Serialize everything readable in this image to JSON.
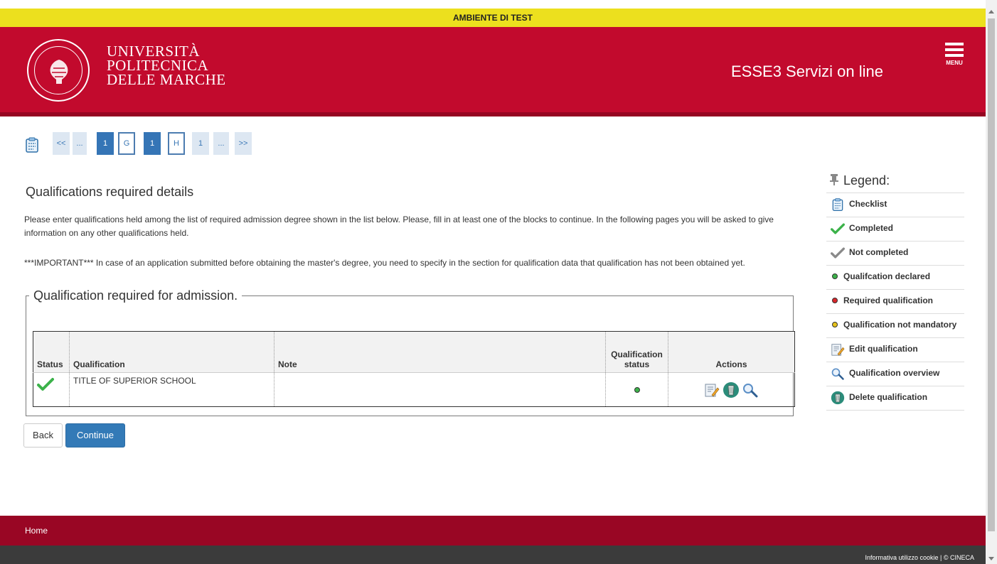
{
  "banner": {
    "text": "AMBIENTE DI TEST"
  },
  "header": {
    "univ_line1": "UNIVERSITÀ",
    "univ_line2": "POLITECNICA",
    "univ_line3": "DELLE MARCHE",
    "seal_text": "UNIVERSITÀ POLITECNICA DELLE MARCHE",
    "app_title": "ESSE3 Servizi on line",
    "menu_label": "MENU"
  },
  "pager": {
    "items": [
      "<<",
      "...",
      "1",
      "G",
      "1",
      "H",
      "1",
      "...",
      ">>"
    ]
  },
  "main": {
    "title": "Qualifications required details",
    "para1": "Please enter qualifications held among the list of required admission degree shown in the list below. Please, fill in at least one of the blocks to continue. In the following pages you will be asked to give information on any other qualifications held.",
    "para2": "***IMPORTANT*** In case of an application submitted before obtaining the master's degree, you need to specify in the section for qualification data that qualification has not been obtained yet.",
    "fieldset_legend": "Qualification required for admission.",
    "table": {
      "headers": {
        "status": "Status",
        "qualification": "Qualification",
        "note": "Note",
        "qstatus": "Qualification status",
        "actions": "Actions"
      },
      "rows": [
        {
          "qualification": "TITLE OF SUPERIOR SCHOOL",
          "note": ""
        }
      ]
    },
    "back_label": "Back",
    "continue_label": "Continue"
  },
  "legend": {
    "title": "Legend:",
    "items": [
      {
        "label": "Checklist"
      },
      {
        "label": "Completed"
      },
      {
        "label": "Not completed"
      },
      {
        "label": "Qualifcation declared"
      },
      {
        "label": "Required qualification"
      },
      {
        "label": "Qualification not mandatory"
      },
      {
        "label": "Edit qualification"
      },
      {
        "label": "Qualification overview"
      },
      {
        "label": "Delete qualification"
      }
    ]
  },
  "footer": {
    "home": "Home",
    "cookie": "Informativa utilizzo cookie | © CINECA"
  },
  "colors": {
    "brand_red": "#c20a2d",
    "banner_yellow": "#ece01e",
    "primary_blue": "#337ab7",
    "status_green": "#3cb24a",
    "status_red": "#d9262b",
    "status_yellow": "#e6c21a"
  },
  "icons": [
    "checklist-icon",
    "check-green-icon",
    "check-gray-icon",
    "edit-icon",
    "delete-icon",
    "magnifier-icon",
    "pin-icon",
    "menu-icon",
    "university-seal-icon"
  ]
}
